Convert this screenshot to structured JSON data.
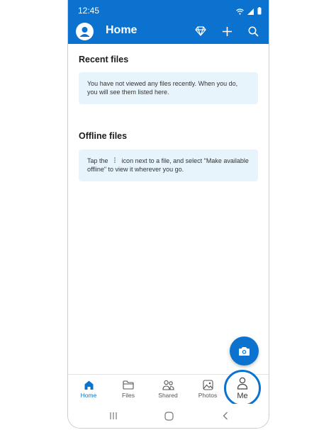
{
  "status": {
    "time": "12:45"
  },
  "appbar": {
    "title": "Home"
  },
  "recent": {
    "title": "Recent files",
    "message": "You have not viewed any files recently. When you do, you will see them listed here."
  },
  "offline": {
    "title": "Offline files",
    "message_before": "Tap the",
    "message_after": "icon next to a file, and select \"Make available offline\" to view it wherever you go."
  },
  "nav": {
    "home": "Home",
    "files": "Files",
    "shared": "Shared",
    "photos": "Photos",
    "me": "Me"
  },
  "colors": {
    "accent": "#0b73cf",
    "card": "#e8f4fc"
  }
}
